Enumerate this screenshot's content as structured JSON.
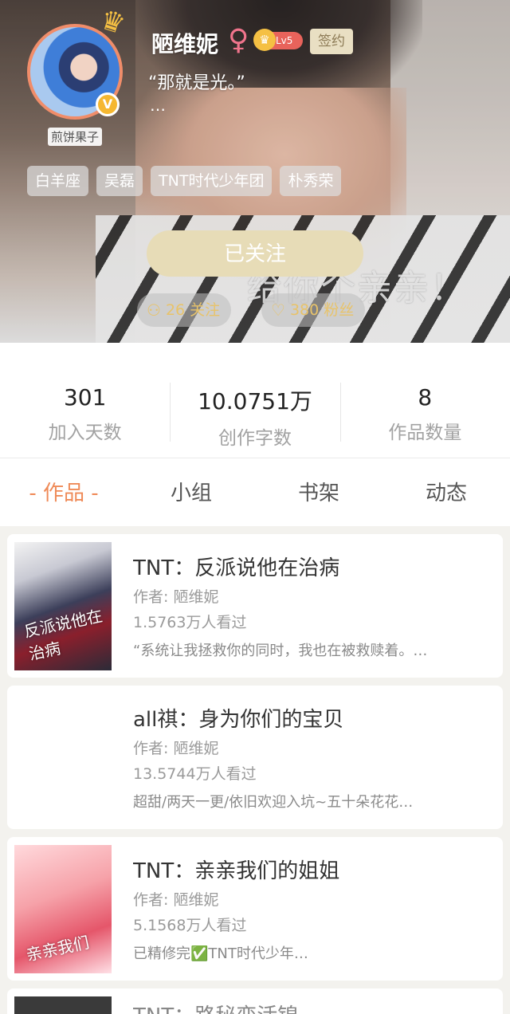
{
  "profile": {
    "name": "陋维妮",
    "level": "Lv5",
    "sign_label": "签约",
    "quote": "“那就是光。”",
    "quote_more": "…",
    "avatar_tag": "煎饼果子",
    "tags": [
      "白羊座",
      "吴磊",
      "TNT时代少年团",
      "朴秀荣"
    ],
    "banner_overlay": "给你个亲亲！",
    "follow_label": "已关注",
    "following_label": "26 关注",
    "fans_label": "380 粉丝"
  },
  "stats": [
    {
      "value": "301",
      "label": "加入天数"
    },
    {
      "value": "10.0751万",
      "label": "创作字数"
    },
    {
      "value": "8",
      "label": "作品数量"
    }
  ],
  "tabs": [
    "- 作品 -",
    "小组",
    "书架",
    "动态"
  ],
  "works": [
    {
      "title": "TNT：反派说他在治病",
      "author": "作者: 陋维妮",
      "views": "1.5763万人看过",
      "desc": "“系统让我拯救你的同时，我也在被救赎着。…",
      "cover_text": "反派说他在治病"
    },
    {
      "title": "all祺：身为你们的宝贝",
      "author": "作者: 陋维妮",
      "views": "13.5744万人看过",
      "desc": "超甜/两天一更/依旧欢迎入坑~五十朵花花…",
      "cover_text": ""
    },
    {
      "title": "TNT：亲亲我们的姐姐",
      "author": "作者: 陋维妮",
      "views": "5.1568万人看过",
      "desc": "已精修完✅TNT时代少年…",
      "cover_text": "亲亲我们"
    },
    {
      "title": "TNT：路秘变活锦",
      "author": "",
      "views": "",
      "desc": "",
      "cover_text": ""
    }
  ],
  "colors": {
    "accent": "#ef8a57",
    "follow_button": "#e7dcb7",
    "stat_pill_text": "#e8c36a"
  }
}
